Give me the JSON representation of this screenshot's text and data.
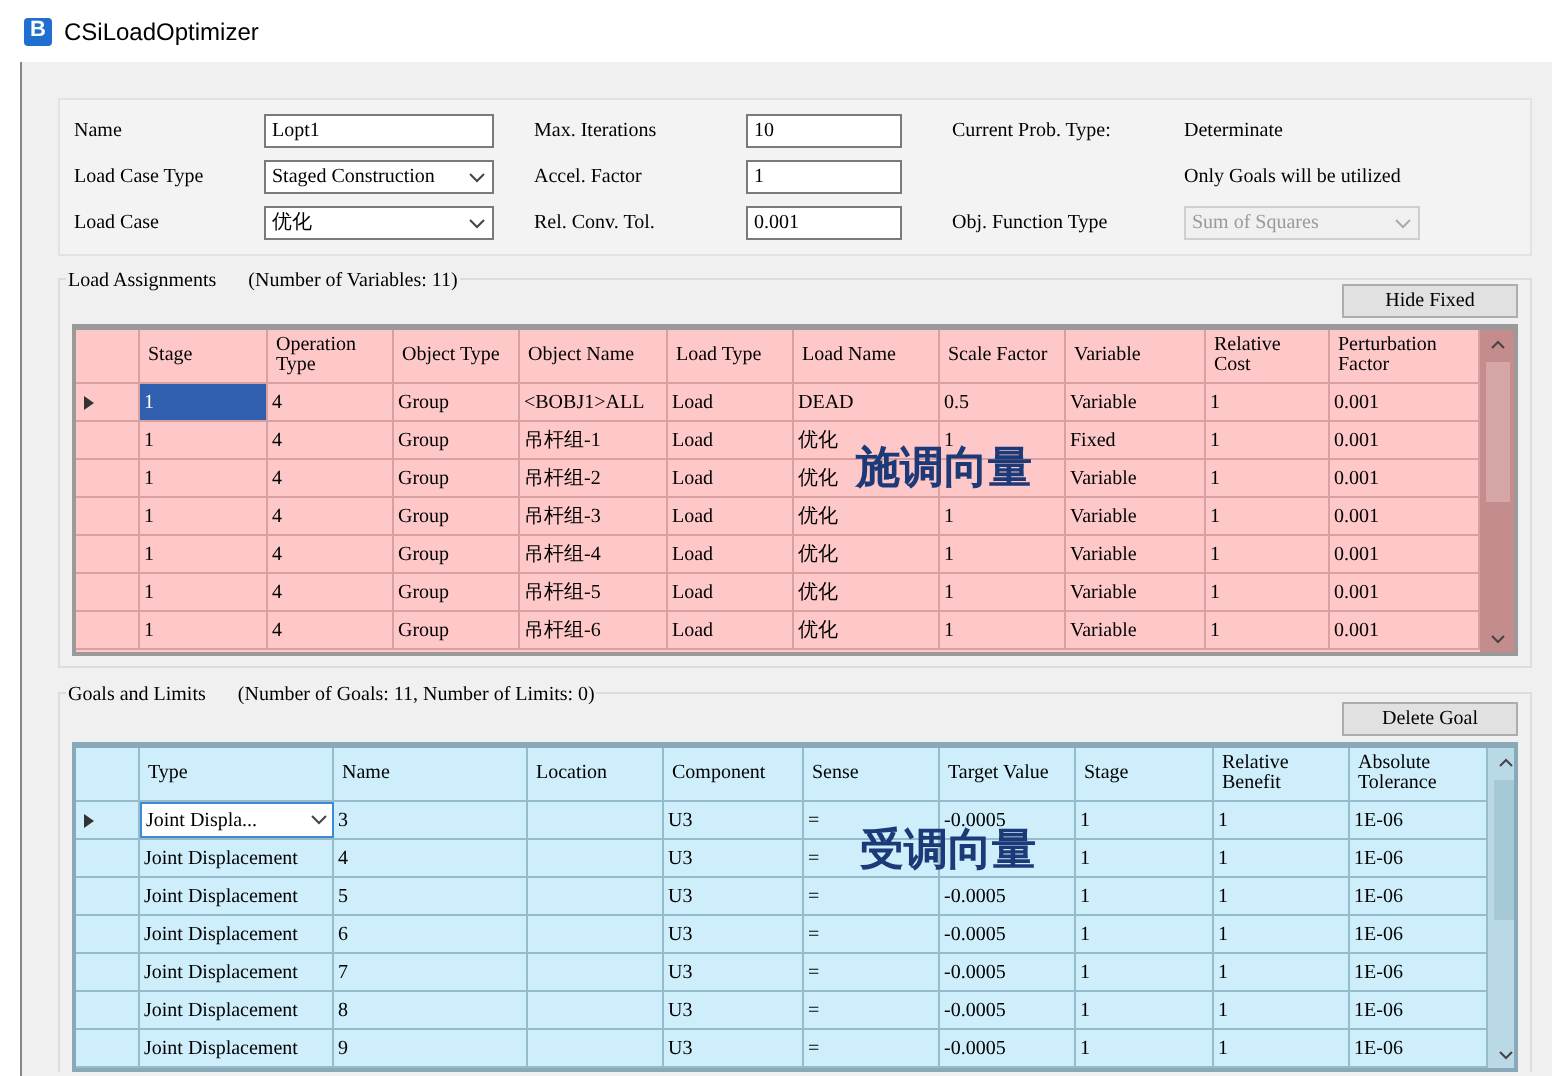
{
  "window": {
    "title": "CSiLoadOptimizer",
    "logo": "B"
  },
  "form": [
    {
      "label": "Name",
      "control": {
        "kind": "input",
        "value": "Lopt1"
      }
    },
    {
      "label": "Max. Iterations",
      "control": {
        "kind": "input",
        "value": "10"
      }
    },
    {
      "label": "Current Prob. Type:",
      "control": {
        "kind": "static",
        "value": "Determinate"
      }
    },
    {
      "label": "Load Case Type",
      "control": {
        "kind": "dropdown",
        "value": "Staged Construction",
        "disabled": false
      }
    },
    {
      "label": "Accel. Factor",
      "control": {
        "kind": "input",
        "value": "1"
      }
    },
    {
      "control": {
        "kind": "static",
        "value": "Only Goals will be utilized"
      }
    },
    {
      "label": "Load Case",
      "control": {
        "kind": "dropdown",
        "value": "优化",
        "disabled": false
      }
    },
    {
      "label": "Rel. Conv. Tol.",
      "control": {
        "kind": "input",
        "value": "0.001"
      }
    },
    {
      "label": "Obj. Function Type",
      "control": {
        "kind": "dropdown",
        "value": "Sum of Squares",
        "disabled": true
      }
    }
  ],
  "load_assignments": {
    "title": "Load Assignments",
    "count": "(Number of Variables: 11)",
    "button": "Hide Fixed",
    "overlay": "施调向量",
    "columns": [
      "Stage",
      "Operation Type",
      "Object Type",
      "Object Name",
      "Load Type",
      "Load Name",
      "Scale Factor",
      "Variable",
      "Relative Cost",
      "Perturbation Factor"
    ],
    "rows": [
      {
        "selected": true,
        "cells": [
          "1",
          "4",
          "Group",
          "<BOBJ1>ALL",
          "Load",
          "DEAD",
          "0.5",
          "Variable",
          "1",
          "0.001"
        ]
      },
      {
        "selected": false,
        "cells": [
          "1",
          "4",
          "Group",
          "吊杆组-1",
          "Load",
          "优化",
          "1",
          "Fixed",
          "1",
          "0.001"
        ]
      },
      {
        "selected": false,
        "cells": [
          "1",
          "4",
          "Group",
          "吊杆组-2",
          "Load",
          "优化",
          "",
          "Variable",
          "1",
          "0.001"
        ]
      },
      {
        "selected": false,
        "cells": [
          "1",
          "4",
          "Group",
          "吊杆组-3",
          "Load",
          "优化",
          "1",
          "Variable",
          "1",
          "0.001"
        ]
      },
      {
        "selected": false,
        "cells": [
          "1",
          "4",
          "Group",
          "吊杆组-4",
          "Load",
          "优化",
          "1",
          "Variable",
          "1",
          "0.001"
        ]
      },
      {
        "selected": false,
        "cells": [
          "1",
          "4",
          "Group",
          "吊杆组-5",
          "Load",
          "优化",
          "1",
          "Variable",
          "1",
          "0.001"
        ]
      },
      {
        "selected": false,
        "cells": [
          "1",
          "4",
          "Group",
          "吊杆组-6",
          "Load",
          "优化",
          "1",
          "Variable",
          "1",
          "0.001"
        ]
      }
    ]
  },
  "goals": {
    "title": "Goals and Limits",
    "count": "(Number of Goals: 11,  Number of Limits: 0)",
    "button": "Delete Goal",
    "overlay": "受调向量",
    "columns": [
      "Type",
      "Name",
      "Location",
      "Component",
      "Sense",
      "Target Value",
      "Stage",
      "Relative Benefit",
      "Absolute Tolerance"
    ],
    "rows": [
      {
        "selected": true,
        "cells": [
          "Joint Displa...",
          "3",
          "",
          "U3",
          "=",
          "-0.0005",
          "1",
          "1",
          "1E-06"
        ]
      },
      {
        "selected": false,
        "cells": [
          "Joint Displacement",
          "4",
          "",
          "U3",
          "=",
          "",
          "1",
          "1",
          "1E-06"
        ]
      },
      {
        "selected": false,
        "cells": [
          "Joint Displacement",
          "5",
          "",
          "U3",
          "=",
          "-0.0005",
          "1",
          "1",
          "1E-06"
        ]
      },
      {
        "selected": false,
        "cells": [
          "Joint Displacement",
          "6",
          "",
          "U3",
          "=",
          "-0.0005",
          "1",
          "1",
          "1E-06"
        ]
      },
      {
        "selected": false,
        "cells": [
          "Joint Displacement",
          "7",
          "",
          "U3",
          "=",
          "-0.0005",
          "1",
          "1",
          "1E-06"
        ]
      },
      {
        "selected": false,
        "cells": [
          "Joint Displacement",
          "8",
          "",
          "U3",
          "=",
          "-0.0005",
          "1",
          "1",
          "1E-06"
        ]
      },
      {
        "selected": false,
        "cells": [
          "Joint Displacement",
          "9",
          "",
          "U3",
          "=",
          "-0.0005",
          "1",
          "1",
          "1E-06"
        ]
      }
    ]
  }
}
